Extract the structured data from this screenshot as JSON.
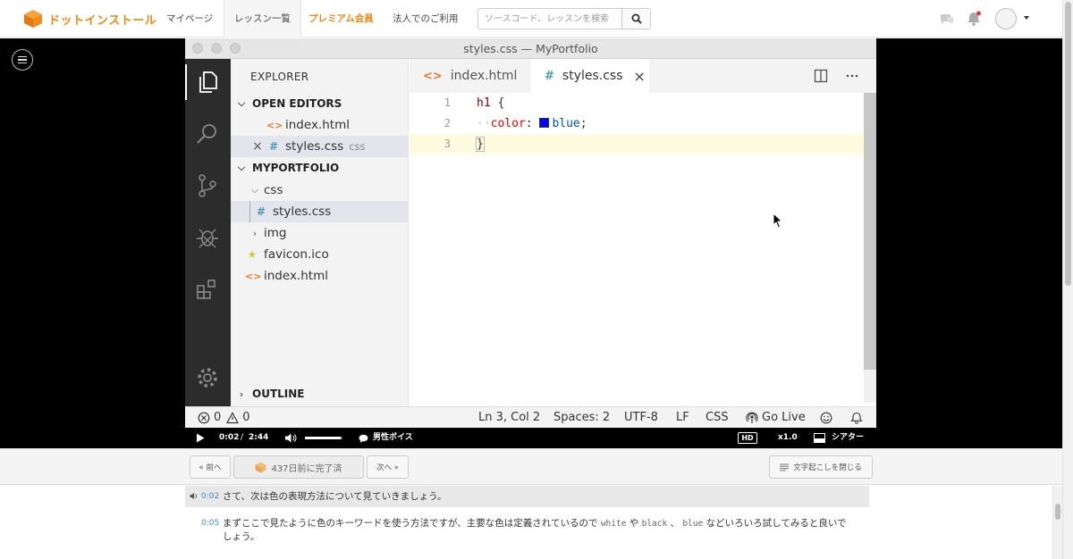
{
  "nav": {
    "logo_text": "ドットインストール",
    "links": [
      "マイページ",
      "レッスン一覧",
      "プレミアム会員",
      "法人でのご利用"
    ],
    "search_placeholder": "ソースコード、レッスンを検索"
  },
  "vscode": {
    "window_title": "styles.css — MyPortfolio",
    "explorer_header": "EXPLORER",
    "open_editors": "OPEN EDITORS",
    "open_files": [
      {
        "name": "index.html",
        "dir": ""
      },
      {
        "name": "styles.css",
        "dir": "css"
      }
    ],
    "project": "MYPORTFOLIO",
    "tree": [
      "css",
      "styles.css",
      "img",
      "favicon.ico",
      "index.html"
    ],
    "outline": "OUTLINE",
    "tabs": [
      "index.html",
      "styles.css"
    ],
    "code": {
      "line_numbers": [
        "1",
        "2",
        "3"
      ],
      "selector": "h1",
      "open_brace": " {",
      "indent": "··",
      "property": "color",
      "colon": ": ",
      "value": "blue",
      "semicolon": ";",
      "close_brace": "}",
      "swatch_color": "#0000ff"
    },
    "status": {
      "errors": "0",
      "warnings": "0",
      "position": "Ln 3, Col 2",
      "spaces": "Spaces: 2",
      "encoding": "UTF-8",
      "eol": "LF",
      "language": "CSS",
      "golive": "Go Live"
    }
  },
  "player": {
    "current_time": "0:02",
    "separator": "/",
    "total_time": "2:44",
    "volume": 0.95,
    "voice": "男性ボイス",
    "quality": "HD",
    "speed": "x1.0",
    "theater": "シアター"
  },
  "lesson": {
    "prev": "« 前へ",
    "completed": "437日前に完了済",
    "next": "次へ »",
    "close_transcript": "文字起こしを閉じる"
  },
  "transcript": [
    {
      "time": "0:02",
      "text": "さて、次は色の表現方法について見ていきましょう。"
    },
    {
      "time": "0:05",
      "text_before": "まずここで見たように色のキーワードを使う方法ですが、主要な色は定義されているので ",
      "kw1": "white",
      "mid1": " や ",
      "kw2": "black",
      "mid2": " 、 ",
      "kw3": "blue",
      "text_after": " などいろいろ試してみると良いでしょう。"
    }
  ]
}
